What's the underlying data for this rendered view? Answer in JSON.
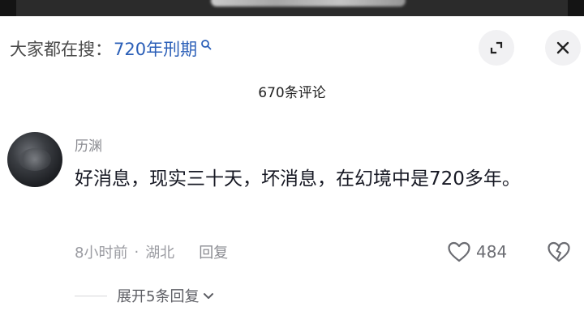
{
  "search": {
    "prefix": "大家都在搜：",
    "term": "720年刑期"
  },
  "comments_header": {
    "count_label": "670条评论"
  },
  "comment": {
    "username": "历渊",
    "text": "好消息，现实三十天，坏消息，在幻境中是720多年。",
    "time": "8小时前",
    "location": "湖北",
    "reply_label": "回复",
    "likes": "484",
    "expand_label": "展开5条回复"
  },
  "colors": {
    "link_blue": "#2b5fb8",
    "muted_gray": "#9a9ba1"
  }
}
